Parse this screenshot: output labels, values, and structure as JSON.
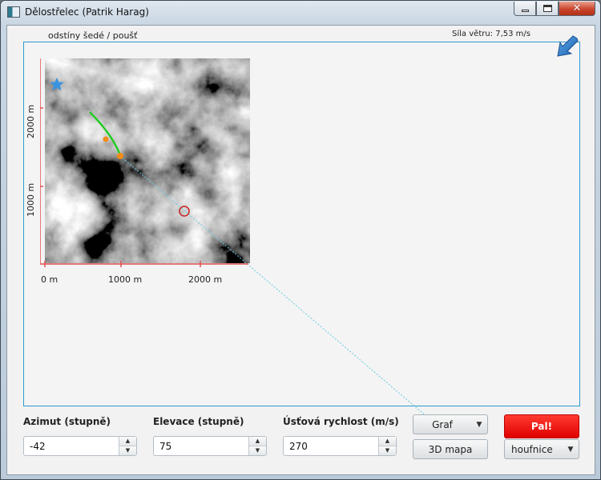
{
  "window": {
    "title": "Dělostřelec (Patrik Harag)",
    "min_glyph": "minimize",
    "max_glyph": "maximize",
    "close_glyph": "✕"
  },
  "header": {
    "color_mode": "odstíny šedé  /  poušť",
    "wind": "Síla větru: 7,53 m/s"
  },
  "map": {
    "x_ticks": [
      "0 m",
      "1000 m",
      "2000 m"
    ],
    "y_ticks": [
      "1000 m",
      "2000 m"
    ],
    "markers": {
      "player": "star",
      "cannon": "orange-dot",
      "target": "red-circle"
    },
    "colors": {
      "axis": "#e05050",
      "trajectory": "#22cc22",
      "aim_line": "#66ccdd",
      "frame": "#2a9bd0"
    }
  },
  "controls": {
    "azimuth": {
      "label": "Azimut (stupně)",
      "value": "-42"
    },
    "elevation": {
      "label": "Elevace (stupně)",
      "value": "75"
    },
    "muzzle_velocity": {
      "label": "Úsťová rychlost (m/s)",
      "value": "270"
    },
    "graph_button": "Graf",
    "map3d_button": "3D mapa",
    "fire_button": "Pal!",
    "weapon_select": "houfnice"
  }
}
